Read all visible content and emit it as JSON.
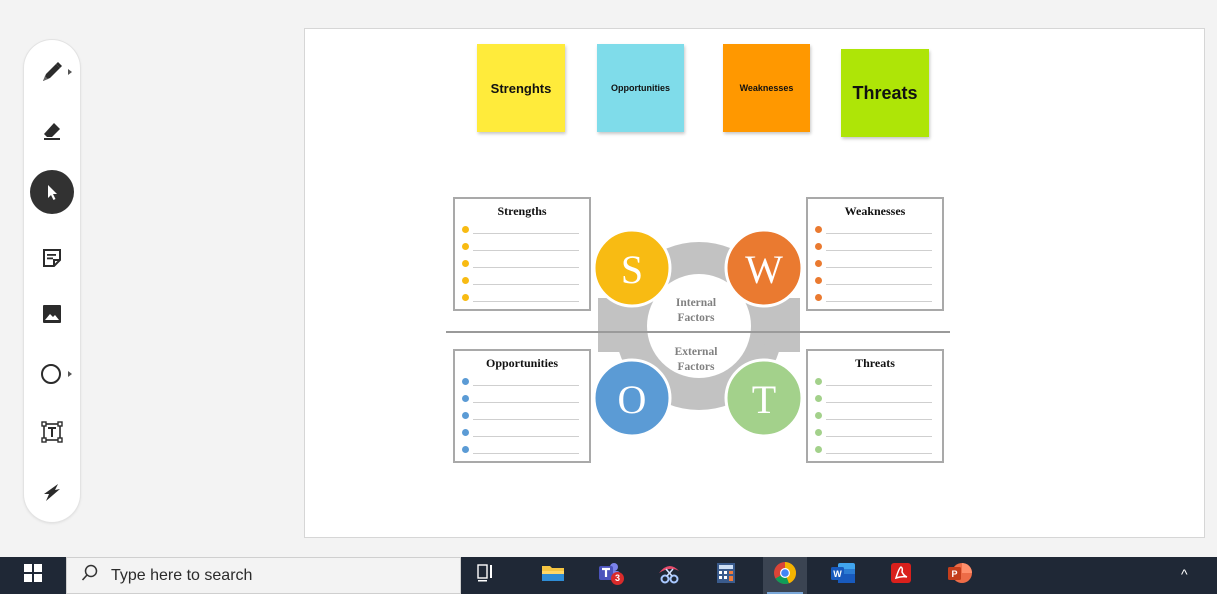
{
  "toolbar": {
    "tools": [
      "pen-tool",
      "eraser-tool",
      "select-tool",
      "sticky-note-tool",
      "image-tool",
      "shape-tool",
      "text-box-tool",
      "ink-to-shape-tool"
    ],
    "active_tool": "select-tool"
  },
  "sticky_notes": [
    {
      "label": "Strenghts",
      "color": "#ffeb3b"
    },
    {
      "label": "Opportunities",
      "color": "#7fdcea"
    },
    {
      "label": "Weaknesses",
      "color": "#ff9800"
    },
    {
      "label": "Threats",
      "color": "#aee507"
    }
  ],
  "swot": {
    "strengths_title": "Strengths",
    "weaknesses_title": "Weaknesses",
    "opportunities_title": "Opportunities",
    "threats_title": "Threats",
    "letters": {
      "s": "S",
      "w": "W",
      "o": "O",
      "t": "T"
    },
    "internal_line1": "Internal",
    "internal_line2": "Factors",
    "external_line1": "External",
    "external_line2": "Factors",
    "colors": {
      "s": "#f8bb13",
      "w": "#ea7a30",
      "o": "#5b9bd5",
      "t": "#a3d18b",
      "connector": "#c2c2c2"
    }
  },
  "taskbar": {
    "search_placeholder": "Type here to search",
    "teams_badge": "3",
    "apps": [
      "task-view-icon",
      "file-explorer-icon",
      "teams-icon",
      "snipping-tool-icon",
      "calculator-icon",
      "chrome-icon",
      "word-icon",
      "acrobat-icon",
      "powerpoint-icon"
    ],
    "tray_arrow": "^"
  }
}
